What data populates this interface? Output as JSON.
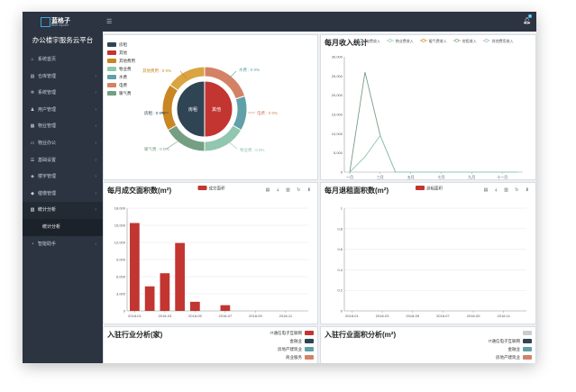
{
  "app": {
    "logo_text": "蓝格子",
    "logo_sub": "Blue Square",
    "title": "办公楼宇服务云平台"
  },
  "menu": [
    {
      "icon": "home-icon",
      "glyph": "⌂",
      "label": "系统首页",
      "chevron": false
    },
    {
      "icon": "cart-icon",
      "glyph": "▤",
      "label": "仓库管理",
      "chevron": true
    },
    {
      "icon": "gear-icon",
      "glyph": "✲",
      "label": "系统管理",
      "chevron": true
    },
    {
      "icon": "user-icon",
      "glyph": "♟",
      "label": "用户管理",
      "chevron": true
    },
    {
      "icon": "building-icon",
      "glyph": "▦",
      "label": "物业管理",
      "chevron": true
    },
    {
      "icon": "print-icon",
      "glyph": "▭",
      "label": "物业办公",
      "chevron": true
    },
    {
      "icon": "list-icon",
      "glyph": "☰",
      "label": "基础设置",
      "chevron": true
    },
    {
      "icon": "layers-icon",
      "glyph": "◈",
      "label": "楼宇管理",
      "chevron": true
    },
    {
      "icon": "tag-icon",
      "glyph": "◆",
      "label": "催缴管理",
      "chevron": true
    },
    {
      "icon": "bar-chart-icon",
      "glyph": "▥",
      "label": "统计分析",
      "chevron": true,
      "active": true
    },
    {
      "icon": "",
      "glyph": "",
      "label": "统计分析",
      "chevron": false,
      "sub": true
    },
    {
      "icon": "pie-icon",
      "glyph": "◔",
      "label": "智能助手",
      "chevron": true
    }
  ],
  "topbar": {
    "badge": "5",
    "user": "FH"
  },
  "panels": {
    "income_pie": {
      "legend": [
        {
          "label": "房租",
          "color": "#2f4554"
        },
        {
          "label": "其他",
          "color": "#c23531"
        },
        {
          "label": "其他费用",
          "color": "#ca8622"
        },
        {
          "label": "物业费",
          "color": "#91c7ae"
        },
        {
          "label": "水费",
          "color": "#61a0a8"
        },
        {
          "label": "电费",
          "color": "#d48265"
        },
        {
          "label": "暖气费",
          "color": "#749f83"
        }
      ],
      "inner_left": "房租",
      "inner_right": "其他",
      "callouts": [
        {
          "text": "其他费用 : 0  0%",
          "color": "#ca8622"
        },
        {
          "text": "水费 : 0  0%",
          "color": "#61a0a8"
        },
        {
          "text": "房租 : 0  0%",
          "color": "#2f4554"
        },
        {
          "text": "电费 : 0  0%",
          "color": "#d48265"
        },
        {
          "text": "暖气费 : 0  0%",
          "color": "#749f83"
        },
        {
          "text": "物业费 : 0  0%",
          "color": "#91c7ae"
        }
      ]
    },
    "monthly_income": {
      "title": "每月收入统计",
      "legend": [
        "电费收入",
        "物业费收入",
        "暖气费收入",
        "房租收入",
        "其他费用收入"
      ]
    },
    "monthly_deal": {
      "title": "每月成交面积数(m²)",
      "legend": "成交面积"
    },
    "monthly_return": {
      "title": "每月退租面积数(m²)",
      "legend": "退租面积"
    },
    "industry_count": {
      "title": "入驻行业分析(家)",
      "legend": [
        {
          "label": "IT通信电子互联网",
          "color": "#c23531"
        },
        {
          "label": "金融业",
          "color": "#2f4554"
        },
        {
          "label": "房地产建筑业",
          "color": "#61a0a8"
        },
        {
          "label": "商业服务",
          "color": "#d48265"
        }
      ]
    },
    "industry_area": {
      "title": "入驻行业面积分析(m²)",
      "legend": [
        {
          "label": "",
          "color": "#cccccc"
        },
        {
          "label": "IT通信电子互联网",
          "color": "#2f4554"
        },
        {
          "label": "金融业",
          "color": "#61a0a8"
        },
        {
          "label": "房地产建筑业",
          "color": "#d48265"
        }
      ]
    }
  },
  "chart_data": [
    {
      "type": "pie",
      "categories": [
        "房租",
        "其他",
        "其他费用",
        "物业费",
        "水费",
        "电费",
        "暖气费"
      ],
      "values": [
        0,
        0,
        0,
        0,
        0,
        0,
        0
      ],
      "title": ""
    },
    {
      "type": "line",
      "title": "每月收入统计",
      "x": [
        "一月",
        "三月",
        "五月",
        "七月",
        "九月",
        "十一月"
      ],
      "ylim": [
        0,
        30000
      ],
      "yticks": [
        0,
        5000,
        10000,
        15000,
        20000,
        25000,
        30000
      ],
      "ytick_labels": [
        "0",
        "5,000",
        "10,000",
        "15,000",
        "20,000",
        "25,000",
        "30,000"
      ],
      "series": [
        {
          "name": "房租收入",
          "color": "#749f83",
          "values": [
            0,
            26000,
            9500,
            0,
            0,
            0,
            0,
            0,
            0,
            0,
            0,
            0
          ]
        },
        {
          "name": "物业费收入",
          "color": "#91c7ae",
          "values": [
            0,
            4000,
            9500,
            0,
            0,
            0,
            0,
            0,
            0,
            0,
            0,
            0
          ]
        }
      ]
    },
    {
      "type": "bar",
      "title": "每月成交面积数(m²)",
      "categories": [
        "2018-01",
        "2018-02",
        "2018-03",
        "2018-04",
        "2018-05",
        "2018-06",
        "2018-07",
        "2018-08",
        "2018-09",
        "2018-10",
        "2018-11",
        "2018-12"
      ],
      "xtick_labels": [
        "2018-01",
        "2018-03",
        "2018-05",
        "2018-07",
        "2018-09",
        "2018-11"
      ],
      "values": [
        15400,
        4300,
        6600,
        11900,
        1600,
        0,
        1000,
        0,
        0,
        0,
        0,
        0
      ],
      "ylim": [
        0,
        18000
      ],
      "yticks": [
        "0",
        "3,000",
        "6,000",
        "9,000",
        "12,000",
        "15,000",
        "18,000"
      ],
      "series_name": "成交面积",
      "color": "#c23531"
    },
    {
      "type": "bar",
      "title": "每月退租面积数(m²)",
      "categories": [
        "2018-01",
        "2018-02",
        "2018-03",
        "2018-04",
        "2018-05",
        "2018-06",
        "2018-07",
        "2018-08",
        "2018-09",
        "2018-10",
        "2018-11",
        "2018-12"
      ],
      "xtick_labels": [
        "2018-01",
        "2018-03",
        "2018-05",
        "2018-07",
        "2018-09",
        "2018-11"
      ],
      "values": [
        0,
        0,
        0,
        0,
        0,
        0,
        0,
        0,
        0,
        0,
        0,
        0
      ],
      "ylim": [
        0,
        1
      ],
      "yticks": [
        "0",
        "0.2",
        "0.4",
        "0.6",
        "0.8",
        "1"
      ],
      "series_name": "退租面积",
      "color": "#c23531"
    }
  ]
}
